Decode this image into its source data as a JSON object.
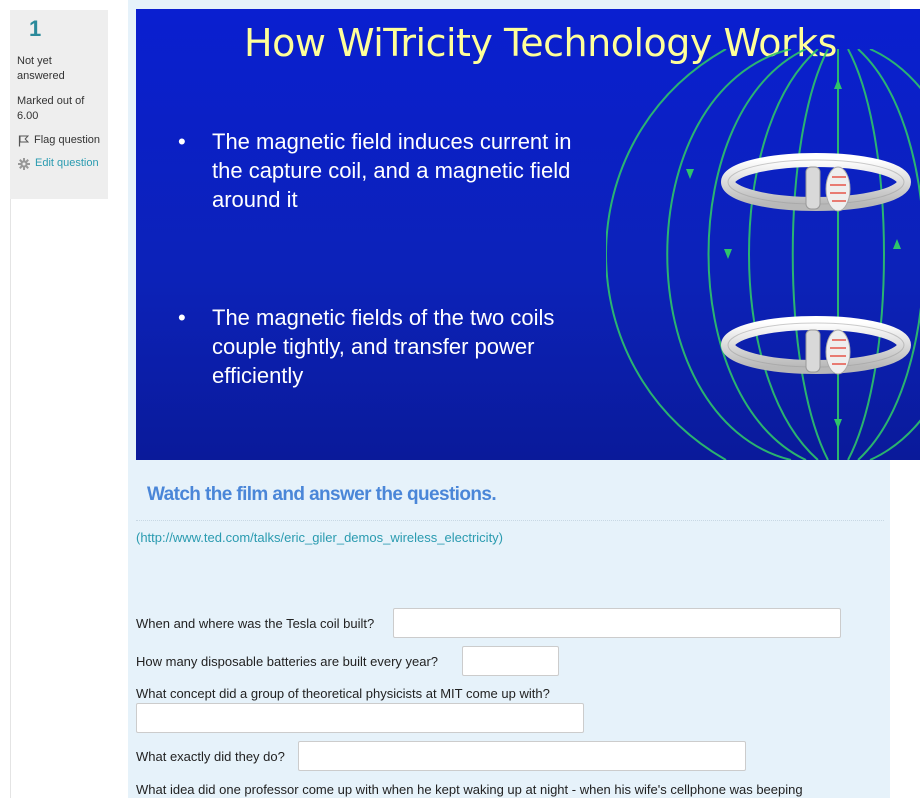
{
  "question_info": {
    "number": "1",
    "state": "Not yet answered",
    "marked_out_of": "Marked out of 6.00",
    "flag_label": "Flag question",
    "edit_label": "Edit question",
    "flag_icon": "flag-icon",
    "edit_icon": "gear-icon"
  },
  "slide": {
    "title": "How WiTricity Technology Works",
    "bullet_symbol": "•",
    "bullets": [
      "The magnetic field induces current in the capture coil, and a magnetic field around it",
      "The magnetic fields of the two coils couple tightly, and transfer power efficiently"
    ]
  },
  "heading": "Watch the film and answer the questions.",
  "source_link": "(http://www.ted.com/talks/eric_giler_demos_wireless_electricity)",
  "questions": [
    {
      "text": "When and where was the Tesla coil built?",
      "answer": ""
    },
    {
      "text": "How many disposable batteries are built every year?",
      "answer": ""
    },
    {
      "text": "What concept did a group of theoretical physicists at MIT come up with?",
      "answer": ""
    },
    {
      "text": "What exactly did they do?",
      "answer": ""
    },
    {
      "text": "What idea did one professor come up with when he kept waking up at night - when his wife's cellphone was beeping",
      "answer": null
    }
  ],
  "colors": {
    "question_number": "#2a8a9b",
    "link": "#2a9bb0",
    "heading": "#4a86d8",
    "content_background": "#e6f2fa",
    "slide_background": "#0c22b8",
    "slide_title": "#ffff99"
  }
}
